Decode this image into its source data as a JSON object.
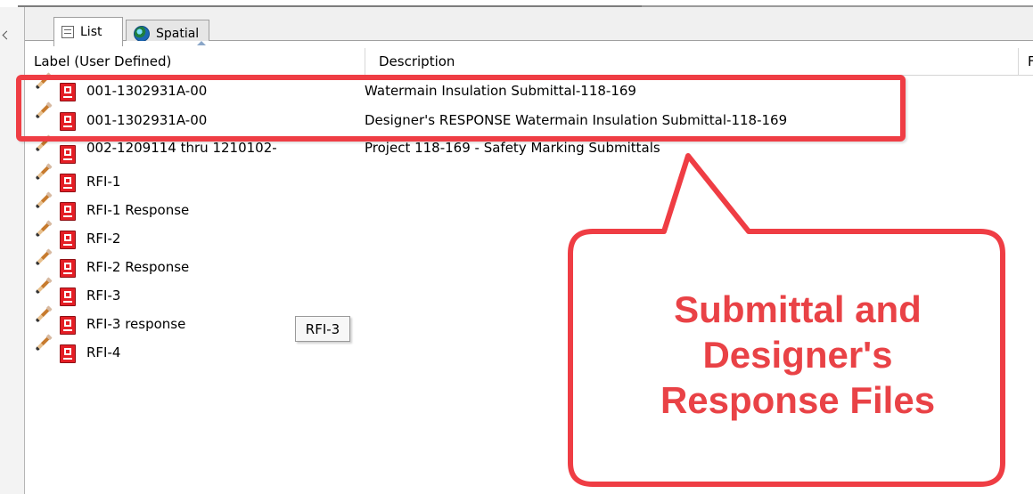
{
  "tabs": [
    {
      "label": "List",
      "icon": "list-icon"
    },
    {
      "label": "Spatial",
      "icon": "globe-icon"
    }
  ],
  "columns": {
    "label": "Label (User Defined)",
    "description": "Description",
    "third": "Fo"
  },
  "rows": [
    {
      "label": "001-1302931A-00",
      "description": "Watermain Insulation Submittal-118-169"
    },
    {
      "label": "001-1302931A-00",
      "description": "Designer's RESPONSE Watermain Insulation Submittal-118-169"
    },
    {
      "label": "002-1209114 thru 1210102-",
      "description": "Project 118-169 - Safety Marking Submittals"
    },
    {
      "label": "RFI-1",
      "description": ""
    },
    {
      "label": "RFI-1 Response",
      "description": ""
    },
    {
      "label": "RFI-2",
      "description": ""
    },
    {
      "label": "RFI-2 Response",
      "description": ""
    },
    {
      "label": "RFI-3",
      "description": ""
    },
    {
      "label": "RFI-3 response",
      "description": ""
    },
    {
      "label": "RFI-4",
      "description": ""
    }
  ],
  "tooltip": "RFI-3",
  "callout": {
    "lines": [
      "Submittal and",
      "Designer's",
      "Response Files"
    ],
    "color": "#e94246",
    "border_color": "#ef3d44"
  }
}
